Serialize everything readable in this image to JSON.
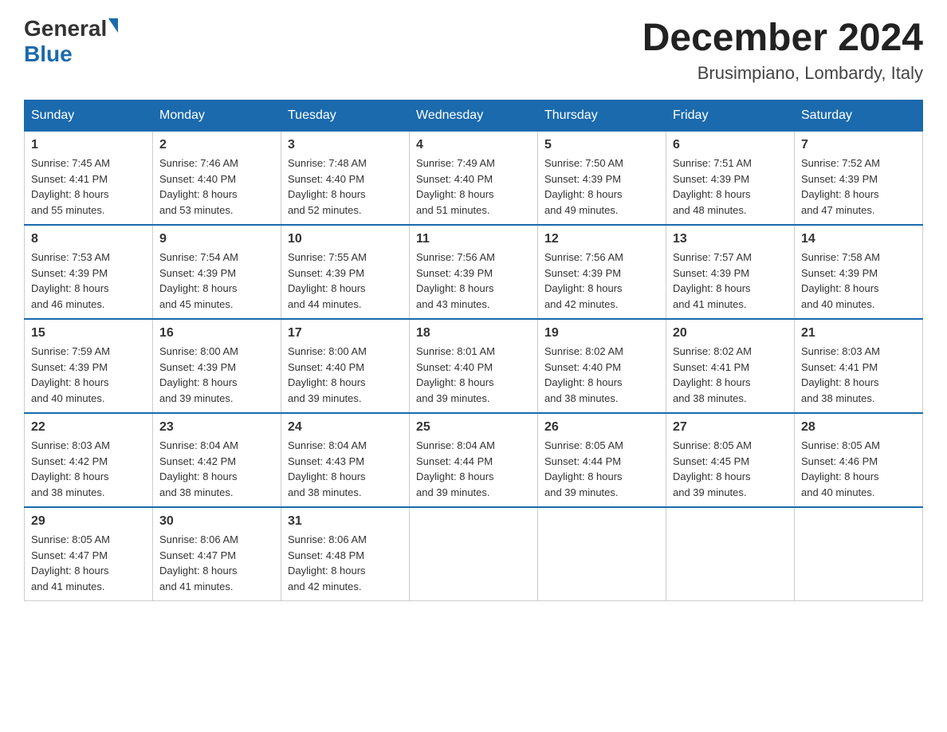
{
  "logo": {
    "general": "General",
    "blue": "Blue"
  },
  "title": "December 2024",
  "location": "Brusimpiano, Lombardy, Italy",
  "days_of_week": [
    "Sunday",
    "Monday",
    "Tuesday",
    "Wednesday",
    "Thursday",
    "Friday",
    "Saturday"
  ],
  "weeks": [
    [
      {
        "day": "1",
        "sunrise": "7:45 AM",
        "sunset": "4:41 PM",
        "daylight": "8 hours and 55 minutes."
      },
      {
        "day": "2",
        "sunrise": "7:46 AM",
        "sunset": "4:40 PM",
        "daylight": "8 hours and 53 minutes."
      },
      {
        "day": "3",
        "sunrise": "7:48 AM",
        "sunset": "4:40 PM",
        "daylight": "8 hours and 52 minutes."
      },
      {
        "day": "4",
        "sunrise": "7:49 AM",
        "sunset": "4:40 PM",
        "daylight": "8 hours and 51 minutes."
      },
      {
        "day": "5",
        "sunrise": "7:50 AM",
        "sunset": "4:39 PM",
        "daylight": "8 hours and 49 minutes."
      },
      {
        "day": "6",
        "sunrise": "7:51 AM",
        "sunset": "4:39 PM",
        "daylight": "8 hours and 48 minutes."
      },
      {
        "day": "7",
        "sunrise": "7:52 AM",
        "sunset": "4:39 PM",
        "daylight": "8 hours and 47 minutes."
      }
    ],
    [
      {
        "day": "8",
        "sunrise": "7:53 AM",
        "sunset": "4:39 PM",
        "daylight": "8 hours and 46 minutes."
      },
      {
        "day": "9",
        "sunrise": "7:54 AM",
        "sunset": "4:39 PM",
        "daylight": "8 hours and 45 minutes."
      },
      {
        "day": "10",
        "sunrise": "7:55 AM",
        "sunset": "4:39 PM",
        "daylight": "8 hours and 44 minutes."
      },
      {
        "day": "11",
        "sunrise": "7:56 AM",
        "sunset": "4:39 PM",
        "daylight": "8 hours and 43 minutes."
      },
      {
        "day": "12",
        "sunrise": "7:56 AM",
        "sunset": "4:39 PM",
        "daylight": "8 hours and 42 minutes."
      },
      {
        "day": "13",
        "sunrise": "7:57 AM",
        "sunset": "4:39 PM",
        "daylight": "8 hours and 41 minutes."
      },
      {
        "day": "14",
        "sunrise": "7:58 AM",
        "sunset": "4:39 PM",
        "daylight": "8 hours and 40 minutes."
      }
    ],
    [
      {
        "day": "15",
        "sunrise": "7:59 AM",
        "sunset": "4:39 PM",
        "daylight": "8 hours and 40 minutes."
      },
      {
        "day": "16",
        "sunrise": "8:00 AM",
        "sunset": "4:39 PM",
        "daylight": "8 hours and 39 minutes."
      },
      {
        "day": "17",
        "sunrise": "8:00 AM",
        "sunset": "4:40 PM",
        "daylight": "8 hours and 39 minutes."
      },
      {
        "day": "18",
        "sunrise": "8:01 AM",
        "sunset": "4:40 PM",
        "daylight": "8 hours and 39 minutes."
      },
      {
        "day": "19",
        "sunrise": "8:02 AM",
        "sunset": "4:40 PM",
        "daylight": "8 hours and 38 minutes."
      },
      {
        "day": "20",
        "sunrise": "8:02 AM",
        "sunset": "4:41 PM",
        "daylight": "8 hours and 38 minutes."
      },
      {
        "day": "21",
        "sunrise": "8:03 AM",
        "sunset": "4:41 PM",
        "daylight": "8 hours and 38 minutes."
      }
    ],
    [
      {
        "day": "22",
        "sunrise": "8:03 AM",
        "sunset": "4:42 PM",
        "daylight": "8 hours and 38 minutes."
      },
      {
        "day": "23",
        "sunrise": "8:04 AM",
        "sunset": "4:42 PM",
        "daylight": "8 hours and 38 minutes."
      },
      {
        "day": "24",
        "sunrise": "8:04 AM",
        "sunset": "4:43 PM",
        "daylight": "8 hours and 38 minutes."
      },
      {
        "day": "25",
        "sunrise": "8:04 AM",
        "sunset": "4:44 PM",
        "daylight": "8 hours and 39 minutes."
      },
      {
        "day": "26",
        "sunrise": "8:05 AM",
        "sunset": "4:44 PM",
        "daylight": "8 hours and 39 minutes."
      },
      {
        "day": "27",
        "sunrise": "8:05 AM",
        "sunset": "4:45 PM",
        "daylight": "8 hours and 39 minutes."
      },
      {
        "day": "28",
        "sunrise": "8:05 AM",
        "sunset": "4:46 PM",
        "daylight": "8 hours and 40 minutes."
      }
    ],
    [
      {
        "day": "29",
        "sunrise": "8:05 AM",
        "sunset": "4:47 PM",
        "daylight": "8 hours and 41 minutes."
      },
      {
        "day": "30",
        "sunrise": "8:06 AM",
        "sunset": "4:47 PM",
        "daylight": "8 hours and 41 minutes."
      },
      {
        "day": "31",
        "sunrise": "8:06 AM",
        "sunset": "4:48 PM",
        "daylight": "8 hours and 42 minutes."
      },
      null,
      null,
      null,
      null
    ]
  ],
  "labels": {
    "sunrise": "Sunrise:",
    "sunset": "Sunset:",
    "daylight": "Daylight:"
  }
}
